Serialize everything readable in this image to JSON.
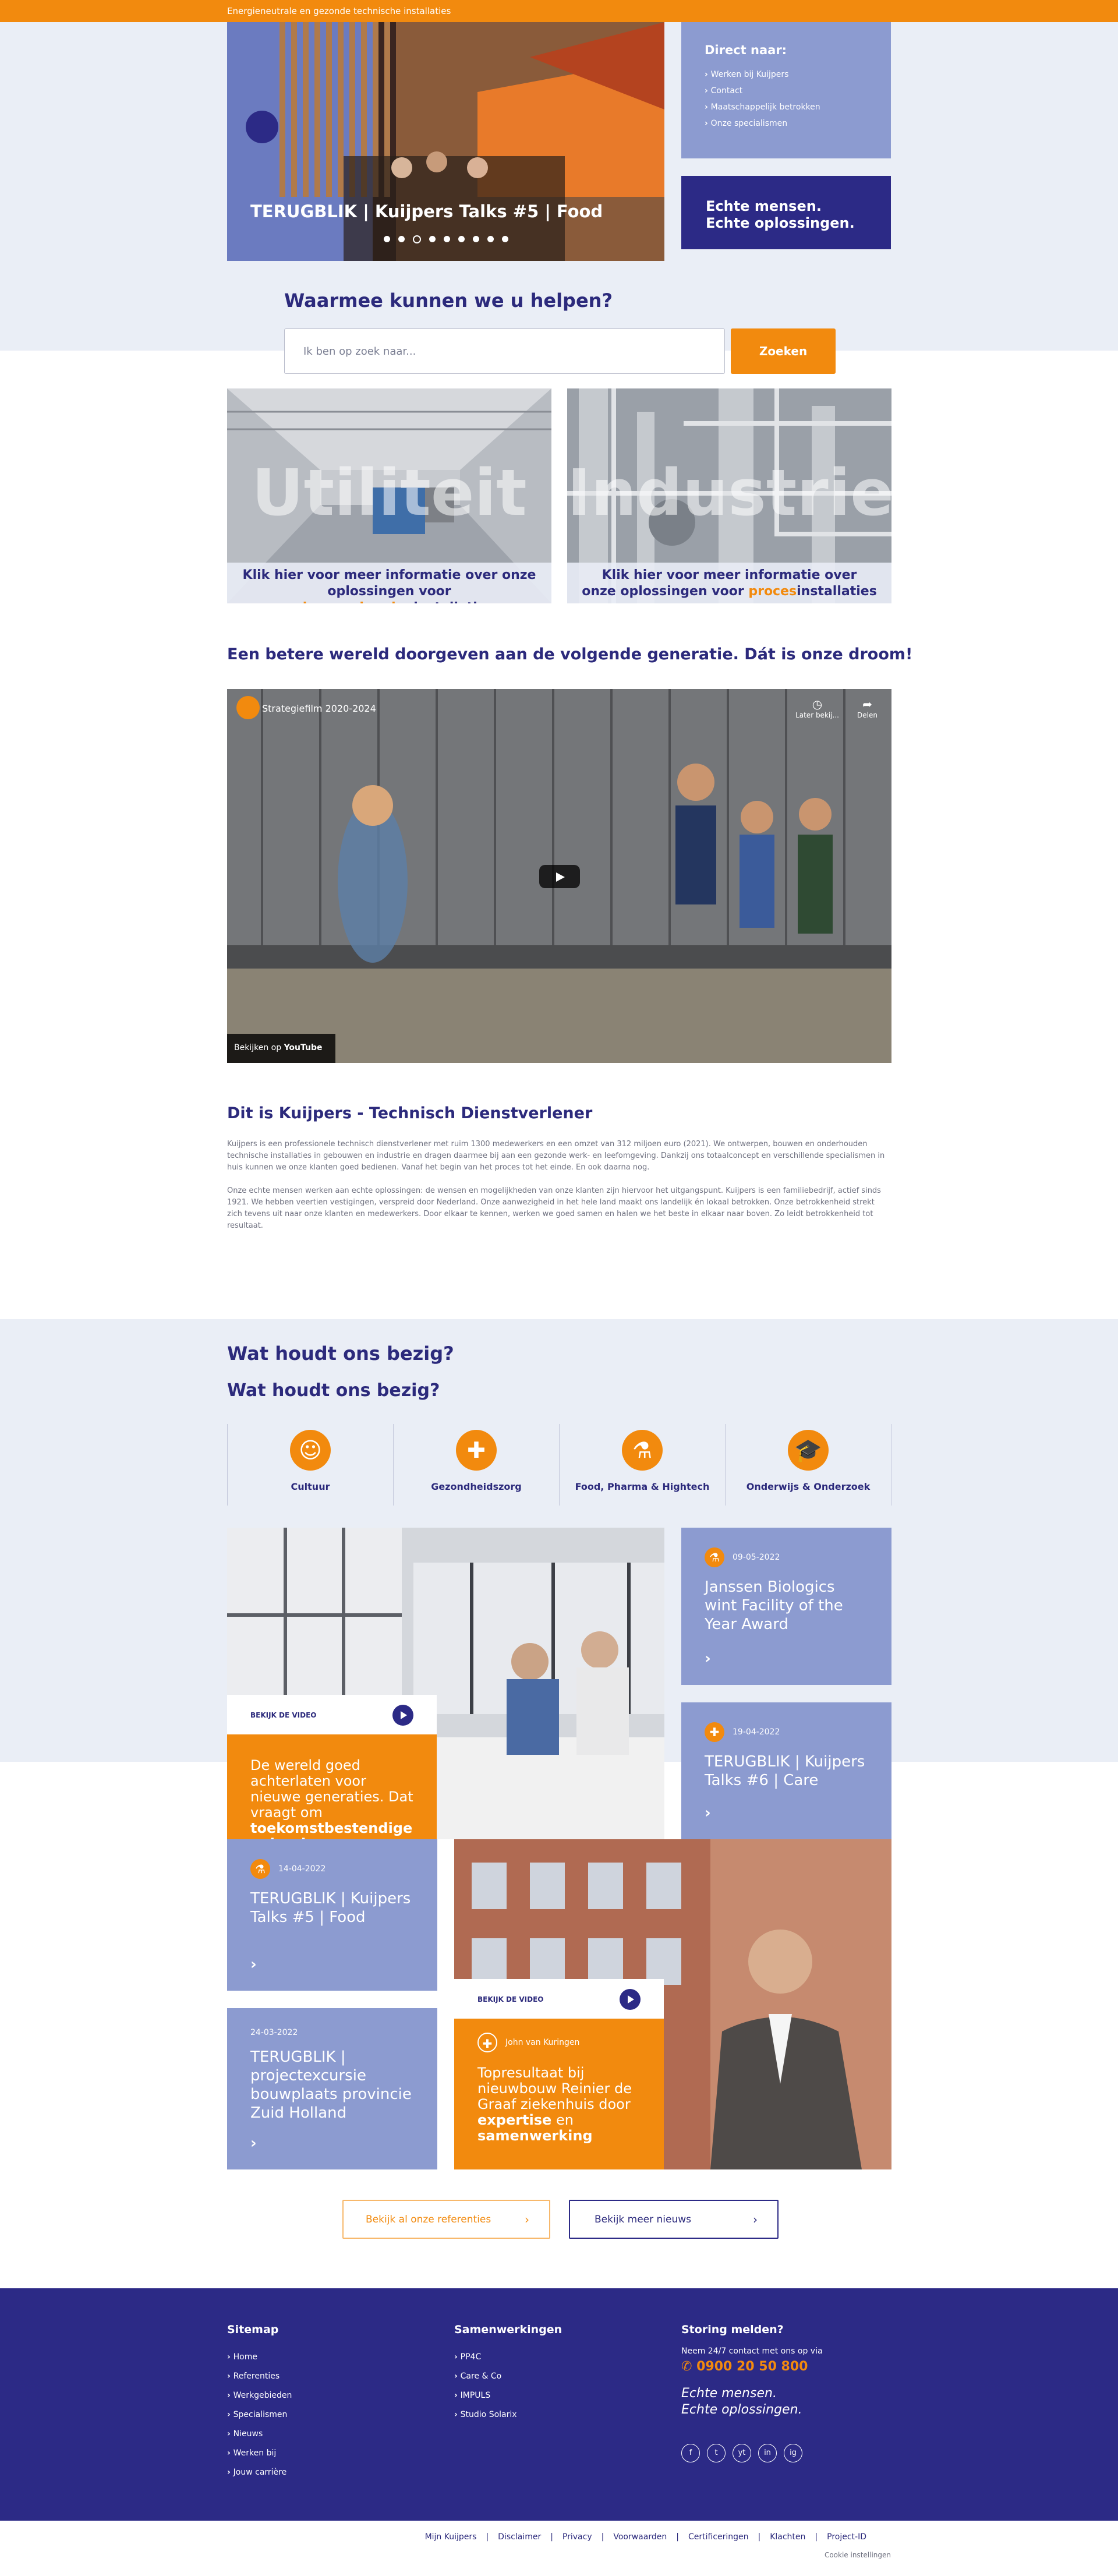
{
  "topbar": {
    "text": "Energieneutrale en gezonde technische installaties"
  },
  "hero": {
    "title": "TERUGBLIK | Kuijpers Talks #5 | Food"
  },
  "direct": {
    "title": "Direct naar:",
    "items": [
      "Werken bij Kuijpers",
      "Contact",
      "Maatschappelijk betrokken",
      "Onze specialismen"
    ]
  },
  "slogan": {
    "line1": "Echte mensen.",
    "line2": "Echte oplossingen."
  },
  "help": {
    "title": "Waarmee kunnen we u helpen?",
    "placeholder": "Ik ben op zoek naar...",
    "button": "Zoeken"
  },
  "categories": [
    {
      "big": "Utiliteit",
      "line1": "Klik hier voor meer informatie over onze",
      "pre": "oplossingen voor ",
      "highlight": "gebouwgebonden",
      "post": "installaties"
    },
    {
      "big": "Industrie",
      "line1": "Klik hier voor meer informatie over",
      "pre": "onze oplossingen voor ",
      "highlight": "proces",
      "post": "installaties"
    }
  ],
  "dream": "Een betere wereld doorgeven aan de volgende generatie. Dát is onze droom!",
  "video": {
    "title": "Strategiefilm 2020-2024",
    "later": "Later bekij...",
    "share": "Delen",
    "watch_on": "Bekijken op",
    "youtube": "YouTube"
  },
  "intro": {
    "title": "Dit is Kuijpers - Technisch Dienstverlener",
    "p1": "Kuijpers is een professionele technisch dienstverlener met ruim 1300 medewerkers en een omzet van 312 miljoen euro (2021). We ontwerpen, bouwen en onderhouden technische installaties in gebouwen en industrie en dragen daarmee bij aan een gezonde werk- en leefomgeving. Dankzij ons totaalconcept en verschillende specialismen in huis kunnen we onze klanten goed bedienen. Vanaf het begin van het proces tot het einde. En ook daarna nog.",
    "p2": "Onze echte mensen werken aan echte oplossingen: de wensen en mogelijkheden van onze klanten zijn hiervoor het uitgangspunt. Kuijpers is een familiebedrijf, actief sinds 1921. We hebben veertien vestigingen, verspreid door Nederland. Onze aanwezigheid in het hele land maakt ons landelijk én lokaal betrokken. Onze betrokkenheid strekt zich tevens uit naar onze klanten en medewerkers. Door elkaar te kennen, werken we goed samen en halen we het beste in elkaar naar boven. Zo leidt betrokkenheid tot resultaat."
  },
  "busy": {
    "title": "Wat houdt ons bezig?",
    "sectors": [
      "Cultuur",
      "Gezondheidszorg",
      "Food, Pharma & Hightech",
      "Onderwijs & Onderzoek"
    ]
  },
  "news": {
    "watch": "BEKIJK DE VIDEO",
    "feature1": {
      "text": "De wereld goed achterlaten voor nieuwe generaties. Dat vraagt om",
      "bold": "toekomstbestendige oplossingen."
    },
    "tile1": {
      "date": "09-05-2022",
      "title": "Janssen Biologics wint Facility of the Year Award"
    },
    "tile2": {
      "date": "19-04-2022",
      "title": "TERUGBLIK | Kuijpers Talks #6 | Care"
    },
    "tile3": {
      "date": "14-04-2022",
      "title": "TERUGBLIK | Kuijpers Talks #5 | Food"
    },
    "tile4": {
      "date": "24-03-2022",
      "title": "TERUGBLIK | projectexcursie bouwplaats provincie Zuid Holland"
    },
    "feature2": {
      "author": "John van Kuringen",
      "text": "Topresultaat bij nieuwbouw Reinier de Graaf ziekenhuis door",
      "bold1": "expertise",
      "mid": " en ",
      "bold2": "samenwerking"
    }
  },
  "buttons": {
    "references": "Bekijk al onze referenties",
    "news": "Bekijk meer nieuws"
  },
  "footer": {
    "sitemap": {
      "title": "Sitemap",
      "items": [
        "Home",
        "Referenties",
        "Werkgebieden",
        "Specialismen",
        "Nieuws",
        "Werken bij",
        "Jouw carrière"
      ]
    },
    "partners": {
      "title": "Samenwerkingen",
      "items": [
        "PP4C",
        "Care & Co",
        "IMPULS",
        "Studio Solarix"
      ]
    },
    "storing": {
      "title": "Storing melden?",
      "sub": "Neem 24/7 contact met ons op via",
      "phone": "0900 20 50 800",
      "line1": "Echte mensen.",
      "line2": "Echte oplossingen."
    },
    "social": [
      "f",
      "t",
      "yt",
      "in",
      "ig"
    ]
  },
  "bottom": {
    "links": [
      "Mijn Kuijpers",
      "Disclaimer",
      "Privacy",
      "Voorwaarden",
      "Certificeringen",
      "Klachten",
      "Project-ID"
    ],
    "cookie": "Cookie instellingen"
  },
  "colors": {
    "orange": "#f28a0e",
    "navy": "#2c2a86",
    "lilac": "#8c9bd0",
    "band": "#eaeef6"
  }
}
